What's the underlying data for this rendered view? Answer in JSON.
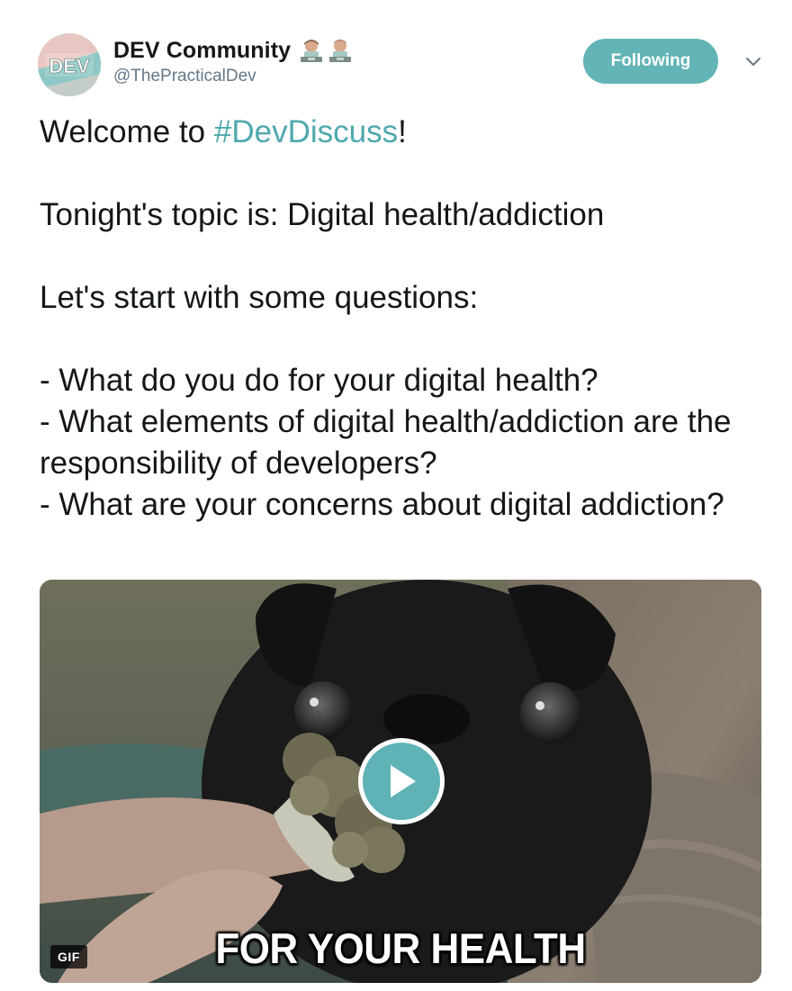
{
  "author": {
    "display_name": "DEV Community",
    "handle": "@ThePracticalDev",
    "avatar_text": "DEV",
    "emojis": [
      "technologist-icon",
      "technologist-icon"
    ]
  },
  "follow_button": {
    "label": "Following",
    "color": "#63b4b7"
  },
  "menu": {
    "icon": "chevron-down-icon"
  },
  "tweet": {
    "welcome_prefix": "Welcome to ",
    "hashtag": "#DevDiscuss",
    "welcome_suffix": "!",
    "topic_line": "Tonight's topic is: Digital health/addiction",
    "questions_intro": "Let's start with some questions:",
    "questions": [
      "- What do you do for your digital health?",
      "- What elements of digital health/addiction are the responsibility of developers?",
      "- What are your concerns about digital addiction?"
    ],
    "hashtag_color": "#4fa9ad"
  },
  "media": {
    "type_badge": "GIF",
    "caption": "FOR YOUR HEALTH",
    "play_icon": "play-icon",
    "play_color": "#5fb3b6"
  }
}
